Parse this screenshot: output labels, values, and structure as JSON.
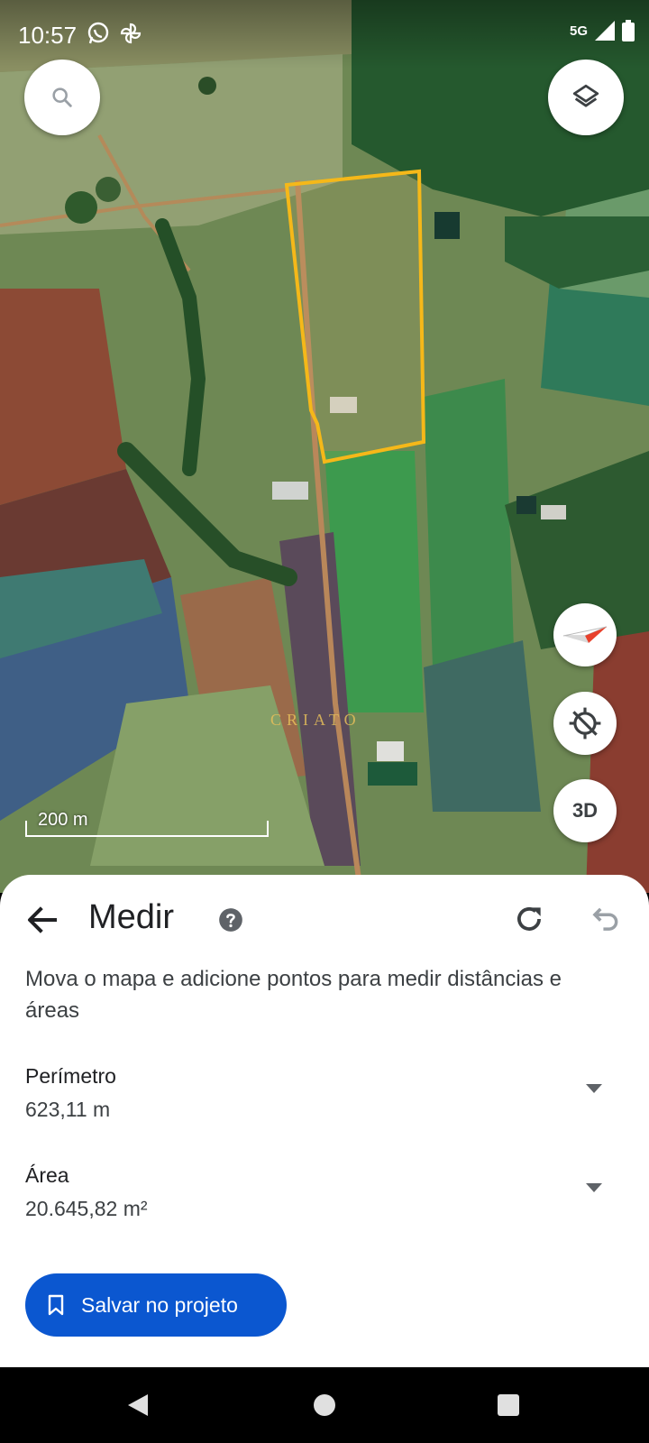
{
  "status": {
    "time": "10:57",
    "network": "5G",
    "left_icons": [
      "whatsapp-icon",
      "pinwheel-icon"
    ]
  },
  "map": {
    "scale_label": "200 m",
    "watermark": "CRIATO",
    "buttons": {
      "search": "search-icon",
      "layers": "layers-icon",
      "compass": "compass-icon",
      "location": "location-off-icon",
      "three_d": "3D"
    },
    "outline_color": "#f5b819"
  },
  "sheet": {
    "title": "Medir",
    "instructions": "Mova o mapa e adicione pontos para medir distâncias e áreas",
    "perimeter": {
      "label": "Perímetro",
      "value": "623,11 m"
    },
    "area": {
      "label": "Área",
      "value": "20.645,82 m²"
    },
    "save_button": "Salvar no projeto",
    "accent_color": "#0b57d0"
  }
}
